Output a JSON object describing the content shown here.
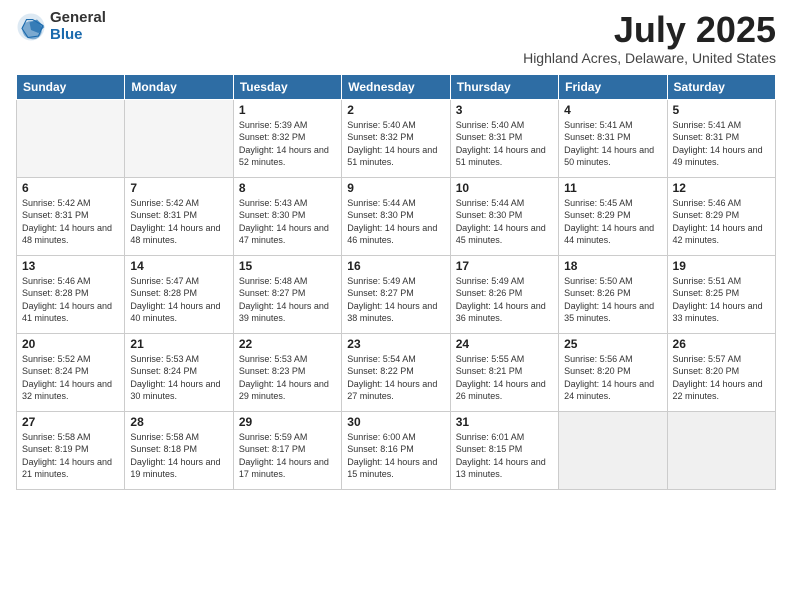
{
  "logo": {
    "general": "General",
    "blue": "Blue"
  },
  "title": "July 2025",
  "location": "Highland Acres, Delaware, United States",
  "days_of_week": [
    "Sunday",
    "Monday",
    "Tuesday",
    "Wednesday",
    "Thursday",
    "Friday",
    "Saturday"
  ],
  "weeks": [
    [
      {
        "day": "",
        "content": ""
      },
      {
        "day": "",
        "content": ""
      },
      {
        "day": "1",
        "content": "Sunrise: 5:39 AM\nSunset: 8:32 PM\nDaylight: 14 hours and 52 minutes."
      },
      {
        "day": "2",
        "content": "Sunrise: 5:40 AM\nSunset: 8:32 PM\nDaylight: 14 hours and 51 minutes."
      },
      {
        "day": "3",
        "content": "Sunrise: 5:40 AM\nSunset: 8:31 PM\nDaylight: 14 hours and 51 minutes."
      },
      {
        "day": "4",
        "content": "Sunrise: 5:41 AM\nSunset: 8:31 PM\nDaylight: 14 hours and 50 minutes."
      },
      {
        "day": "5",
        "content": "Sunrise: 5:41 AM\nSunset: 8:31 PM\nDaylight: 14 hours and 49 minutes."
      }
    ],
    [
      {
        "day": "6",
        "content": "Sunrise: 5:42 AM\nSunset: 8:31 PM\nDaylight: 14 hours and 48 minutes."
      },
      {
        "day": "7",
        "content": "Sunrise: 5:42 AM\nSunset: 8:31 PM\nDaylight: 14 hours and 48 minutes."
      },
      {
        "day": "8",
        "content": "Sunrise: 5:43 AM\nSunset: 8:30 PM\nDaylight: 14 hours and 47 minutes."
      },
      {
        "day": "9",
        "content": "Sunrise: 5:44 AM\nSunset: 8:30 PM\nDaylight: 14 hours and 46 minutes."
      },
      {
        "day": "10",
        "content": "Sunrise: 5:44 AM\nSunset: 8:30 PM\nDaylight: 14 hours and 45 minutes."
      },
      {
        "day": "11",
        "content": "Sunrise: 5:45 AM\nSunset: 8:29 PM\nDaylight: 14 hours and 44 minutes."
      },
      {
        "day": "12",
        "content": "Sunrise: 5:46 AM\nSunset: 8:29 PM\nDaylight: 14 hours and 42 minutes."
      }
    ],
    [
      {
        "day": "13",
        "content": "Sunrise: 5:46 AM\nSunset: 8:28 PM\nDaylight: 14 hours and 41 minutes."
      },
      {
        "day": "14",
        "content": "Sunrise: 5:47 AM\nSunset: 8:28 PM\nDaylight: 14 hours and 40 minutes."
      },
      {
        "day": "15",
        "content": "Sunrise: 5:48 AM\nSunset: 8:27 PM\nDaylight: 14 hours and 39 minutes."
      },
      {
        "day": "16",
        "content": "Sunrise: 5:49 AM\nSunset: 8:27 PM\nDaylight: 14 hours and 38 minutes."
      },
      {
        "day": "17",
        "content": "Sunrise: 5:49 AM\nSunset: 8:26 PM\nDaylight: 14 hours and 36 minutes."
      },
      {
        "day": "18",
        "content": "Sunrise: 5:50 AM\nSunset: 8:26 PM\nDaylight: 14 hours and 35 minutes."
      },
      {
        "day": "19",
        "content": "Sunrise: 5:51 AM\nSunset: 8:25 PM\nDaylight: 14 hours and 33 minutes."
      }
    ],
    [
      {
        "day": "20",
        "content": "Sunrise: 5:52 AM\nSunset: 8:24 PM\nDaylight: 14 hours and 32 minutes."
      },
      {
        "day": "21",
        "content": "Sunrise: 5:53 AM\nSunset: 8:24 PM\nDaylight: 14 hours and 30 minutes."
      },
      {
        "day": "22",
        "content": "Sunrise: 5:53 AM\nSunset: 8:23 PM\nDaylight: 14 hours and 29 minutes."
      },
      {
        "day": "23",
        "content": "Sunrise: 5:54 AM\nSunset: 8:22 PM\nDaylight: 14 hours and 27 minutes."
      },
      {
        "day": "24",
        "content": "Sunrise: 5:55 AM\nSunset: 8:21 PM\nDaylight: 14 hours and 26 minutes."
      },
      {
        "day": "25",
        "content": "Sunrise: 5:56 AM\nSunset: 8:20 PM\nDaylight: 14 hours and 24 minutes."
      },
      {
        "day": "26",
        "content": "Sunrise: 5:57 AM\nSunset: 8:20 PM\nDaylight: 14 hours and 22 minutes."
      }
    ],
    [
      {
        "day": "27",
        "content": "Sunrise: 5:58 AM\nSunset: 8:19 PM\nDaylight: 14 hours and 21 minutes."
      },
      {
        "day": "28",
        "content": "Sunrise: 5:58 AM\nSunset: 8:18 PM\nDaylight: 14 hours and 19 minutes."
      },
      {
        "day": "29",
        "content": "Sunrise: 5:59 AM\nSunset: 8:17 PM\nDaylight: 14 hours and 17 minutes."
      },
      {
        "day": "30",
        "content": "Sunrise: 6:00 AM\nSunset: 8:16 PM\nDaylight: 14 hours and 15 minutes."
      },
      {
        "day": "31",
        "content": "Sunrise: 6:01 AM\nSunset: 8:15 PM\nDaylight: 14 hours and 13 minutes."
      },
      {
        "day": "",
        "content": ""
      },
      {
        "day": "",
        "content": ""
      }
    ]
  ]
}
